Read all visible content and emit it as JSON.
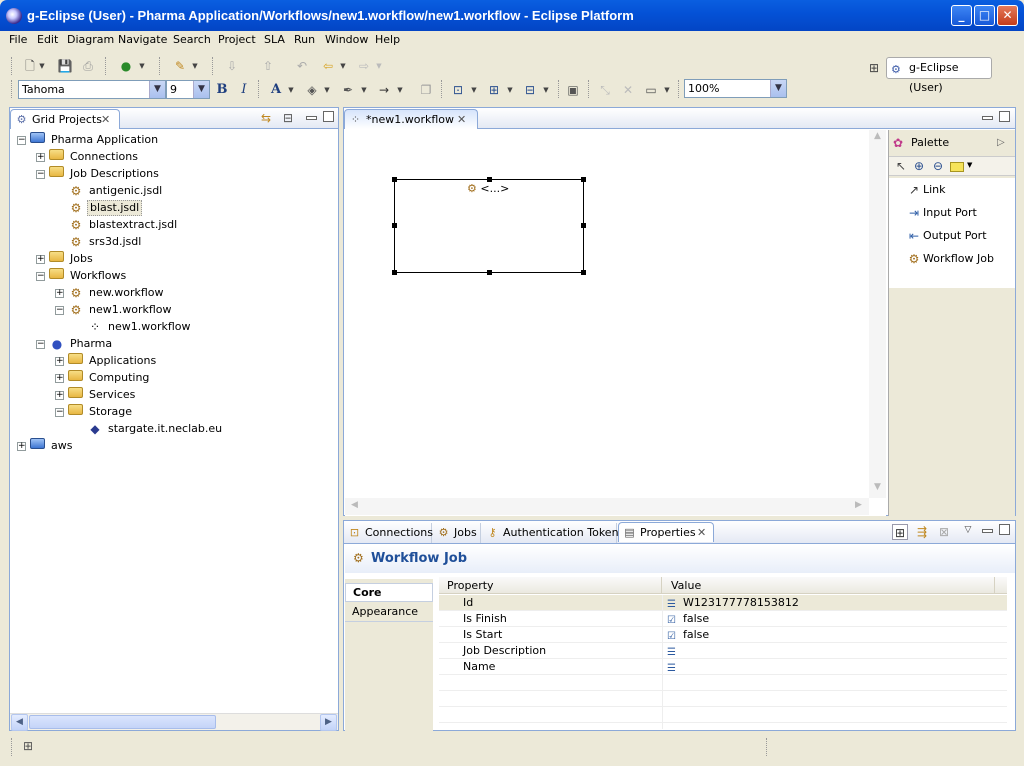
{
  "window": {
    "title": "g-Eclipse (User) - Pharma Application/Workflows/new1.workflow/new1.workflow - Eclipse Platform"
  },
  "menu": [
    "File",
    "Edit",
    "Diagram",
    "Navigate",
    "Search",
    "Project",
    "SLA",
    "Run",
    "Window",
    "Help"
  ],
  "toolbar": {
    "font_name": "Tahoma",
    "font_size": "9",
    "bold_label": "B",
    "italic_label": "I",
    "font_color_label": "A",
    "zoom": "100%"
  },
  "perspective": {
    "label": "g-Eclipse (User)"
  },
  "navigator": {
    "tab_label": "Grid Projects",
    "tree": [
      {
        "label": "Pharma Application",
        "level": 0,
        "expander": "−"
      },
      {
        "label": "Connections",
        "level": 1,
        "expander": "+"
      },
      {
        "label": "Job Descriptions",
        "level": 1,
        "expander": "−"
      },
      {
        "label": "antigenic.jsdl",
        "level": 2,
        "expander": ""
      },
      {
        "label": "blast.jsdl",
        "level": 2,
        "expander": "",
        "selected": true
      },
      {
        "label": "blastextract.jsdl",
        "level": 2,
        "expander": ""
      },
      {
        "label": "srs3d.jsdl",
        "level": 2,
        "expander": ""
      },
      {
        "label": "Jobs",
        "level": 1,
        "expander": "+"
      },
      {
        "label": "Workflows",
        "level": 1,
        "expander": "−"
      },
      {
        "label": "new.workflow",
        "level": 2,
        "expander": "+"
      },
      {
        "label": "new1.workflow",
        "level": 2,
        "expander": "−"
      },
      {
        "label": "new1.workflow",
        "level": 3,
        "expander": ""
      },
      {
        "label": "Pharma",
        "level": 1,
        "expander": "−"
      },
      {
        "label": "Applications",
        "level": 2,
        "expander": "+"
      },
      {
        "label": "Computing",
        "level": 2,
        "expander": "+"
      },
      {
        "label": "Services",
        "level": 2,
        "expander": "+"
      },
      {
        "label": "Storage",
        "level": 2,
        "expander": "−"
      },
      {
        "label": "stargate.it.neclab.eu",
        "level": 3,
        "expander": ""
      },
      {
        "label": "aws",
        "level": 0,
        "expander": "+"
      }
    ]
  },
  "editor": {
    "tab_label": "*new1.workflow",
    "node_label": "<...>"
  },
  "palette": {
    "title": "Palette",
    "items": [
      "Link",
      "Input Port",
      "Output Port",
      "Workflow Job"
    ]
  },
  "bottom_tabs": [
    "Connections",
    "Jobs",
    "Authentication Tokens",
    "Properties"
  ],
  "properties": {
    "heading": "Workflow Job",
    "side_tabs": [
      "Core",
      "Appearance"
    ],
    "columns": [
      "Property",
      "Value"
    ],
    "rows": [
      {
        "name": "Id",
        "value": "W123177778153812",
        "icon": "text-value-icon"
      },
      {
        "name": "Is Finish",
        "value": "false",
        "icon": "boolean-value-icon"
      },
      {
        "name": "Is Start",
        "value": "false",
        "icon": "boolean-value-icon"
      },
      {
        "name": "Job Description",
        "value": "",
        "icon": "text-value-icon"
      },
      {
        "name": "Name",
        "value": "",
        "icon": "text-value-icon"
      }
    ]
  }
}
